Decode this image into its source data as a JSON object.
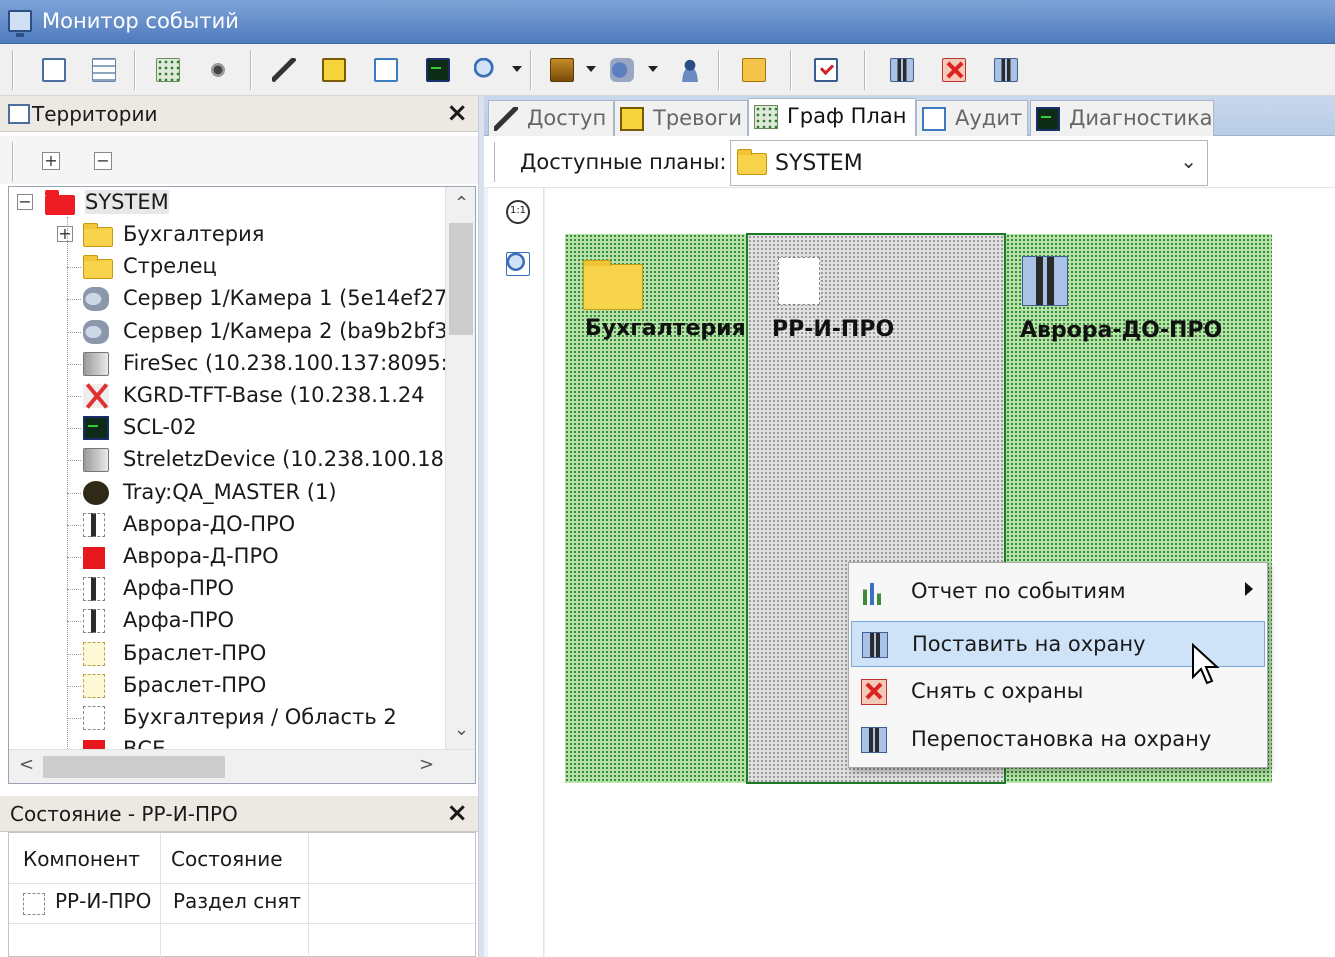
{
  "window": {
    "title": "Монитор событий"
  },
  "territories": {
    "title": "Территории",
    "close": "×",
    "items": [
      {
        "label": "SYSTEM",
        "icon": "red-folder-icon"
      },
      {
        "label": "Бухгалтерия",
        "icon": "folder-icon"
      },
      {
        "label": "Стрелец",
        "icon": "folder-icon"
      },
      {
        "label": "Сервер 1/Камера 1 (5e14ef27",
        "icon": "camera-icon"
      },
      {
        "label": "Сервер 1/Камера 2 (ba9b2bf3",
        "icon": "camera-icon"
      },
      {
        "label": "FireSec (10.238.100.137:8095:",
        "icon": "server-icon"
      },
      {
        "label": "KGRD-TFT-Base (10.238.1.24",
        "icon": "error-x-icon"
      },
      {
        "label": "SCL-02",
        "icon": "terminal-icon"
      },
      {
        "label": "StreletzDevice (10.238.100.18",
        "icon": "server-icon"
      },
      {
        "label": "Tray:QA_MASTER (1)",
        "icon": "chat-icon"
      },
      {
        "label": "Аврора-ДО-ПРО",
        "icon": "guard-icon"
      },
      {
        "label": "Аврора-Д-ПРО",
        "icon": "red-square-icon"
      },
      {
        "label": "Арфа-ПРО",
        "icon": "guard-icon"
      },
      {
        "label": "Арфа-ПРО",
        "icon": "guard-icon"
      },
      {
        "label": "Браслет-ПРО",
        "icon": "yellow-zone-icon"
      },
      {
        "label": "Браслет-ПРО",
        "icon": "yellow-zone-icon"
      },
      {
        "label": "Бухгалтерия / Область 2",
        "icon": "zone-icon"
      },
      {
        "label": "ВСЕ",
        "icon": "red-square-icon"
      }
    ]
  },
  "status": {
    "title": "Состояние - РР-И-ПРО",
    "close": "×",
    "columns": [
      "Компонент",
      "Состояние"
    ],
    "rows": [
      [
        "РР-И-ПРО",
        "Раздел снят"
      ]
    ]
  },
  "tabs": [
    {
      "label": "Доступ",
      "icon": "key-icon"
    },
    {
      "label": "Тревоги",
      "icon": "warning-icon"
    },
    {
      "label": "Граф План",
      "icon": "plan-icon",
      "active": true
    },
    {
      "label": "Аудит",
      "icon": "edit-icon"
    },
    {
      "label": "Диагностика",
      "icon": "terminal-icon"
    }
  ],
  "plans": {
    "label": "Доступные планы:",
    "value": "SYSTEM"
  },
  "canvas": {
    "zones": [
      {
        "label": "Бухгалтерия",
        "icon": "folder-icon"
      },
      {
        "label": "РР-И-ПРО",
        "icon": "zone-icon"
      },
      {
        "label": "Аврора-ДО-ПРО",
        "icon": "guard-icon"
      }
    ]
  },
  "context_menu": [
    {
      "label": "Отчет по событиям",
      "icon": "chart-icon",
      "submenu": true
    },
    {
      "label": "Поставить на охрану",
      "icon": "arm-icon",
      "highlighted": true
    },
    {
      "label": "Снять с охраны",
      "icon": "disarm-icon"
    },
    {
      "label": "Перепостановка на охрану",
      "icon": "rearm-icon"
    }
  ],
  "colors": {
    "titlebar": "#4f7bbd",
    "zone_green": "#2f8d3c",
    "zone_border": "#187a27",
    "menu_highlight": "#cfe3f8"
  }
}
